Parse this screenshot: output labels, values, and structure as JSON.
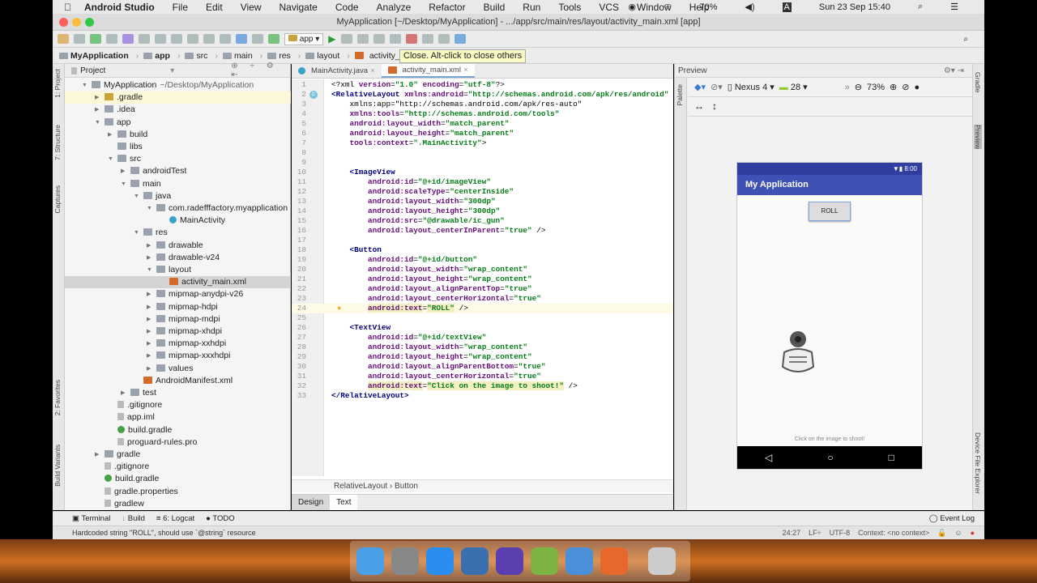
{
  "menubar": {
    "app": "Android Studio",
    "items": [
      "File",
      "Edit",
      "View",
      "Navigate",
      "Code",
      "Analyze",
      "Refactor",
      "Build",
      "Run",
      "Tools",
      "VCS",
      "Window",
      "Help"
    ],
    "battery": "70%",
    "datetime": "Sun 23 Sep  15:40"
  },
  "window": {
    "title": "MyApplication [~/Desktop/MyApplication] - .../app/src/main/res/layout/activity_main.xml [app]"
  },
  "toolbar": {
    "run_config": "app"
  },
  "breadcrumb": [
    "MyApplication",
    "app",
    "src",
    "main",
    "res",
    "layout",
    "activity_main.xml"
  ],
  "tooltip": "Close. Alt-click to close others",
  "left_strip": [
    "1: Project",
    "7: Structure",
    "Captures",
    "2: Favorites",
    "Build Variants"
  ],
  "project": {
    "header": "Project",
    "tree": [
      {
        "label": "MyApplication",
        "suffix": "~/Desktop/MyApplication",
        "level": 0,
        "icon": "folder",
        "open": true
      },
      {
        "label": ".gradle",
        "level": 1,
        "icon": "folder-yellow",
        "open": false,
        "hl": true
      },
      {
        "label": ".idea",
        "level": 1,
        "icon": "folder",
        "open": false
      },
      {
        "label": "app",
        "level": 1,
        "icon": "folder",
        "open": true
      },
      {
        "label": "build",
        "level": 2,
        "icon": "folder",
        "open": false
      },
      {
        "label": "libs",
        "level": 2,
        "icon": "folder"
      },
      {
        "label": "src",
        "level": 2,
        "icon": "folder",
        "open": true
      },
      {
        "label": "androidTest",
        "level": 3,
        "icon": "folder",
        "open": false
      },
      {
        "label": "main",
        "level": 3,
        "icon": "folder",
        "open": true
      },
      {
        "label": "java",
        "level": 4,
        "icon": "folder",
        "open": true
      },
      {
        "label": "com.radefffactory.myapplication",
        "level": 5,
        "icon": "folder",
        "open": true
      },
      {
        "label": "MainActivity",
        "level": 6,
        "icon": "class"
      },
      {
        "label": "res",
        "level": 4,
        "icon": "folder",
        "open": true
      },
      {
        "label": "drawable",
        "level": 5,
        "icon": "folder",
        "open": false
      },
      {
        "label": "drawable-v24",
        "level": 5,
        "icon": "folder",
        "open": false
      },
      {
        "label": "layout",
        "level": 5,
        "icon": "folder",
        "open": true
      },
      {
        "label": "activity_main.xml",
        "level": 6,
        "icon": "xml",
        "sel": true
      },
      {
        "label": "mipmap-anydpi-v26",
        "level": 5,
        "icon": "folder",
        "open": false
      },
      {
        "label": "mipmap-hdpi",
        "level": 5,
        "icon": "folder",
        "open": false
      },
      {
        "label": "mipmap-mdpi",
        "level": 5,
        "icon": "folder",
        "open": false
      },
      {
        "label": "mipmap-xhdpi",
        "level": 5,
        "icon": "folder",
        "open": false
      },
      {
        "label": "mipmap-xxhdpi",
        "level": 5,
        "icon": "folder",
        "open": false
      },
      {
        "label": "mipmap-xxxhdpi",
        "level": 5,
        "icon": "folder",
        "open": false
      },
      {
        "label": "values",
        "level": 5,
        "icon": "folder",
        "open": false
      },
      {
        "label": "AndroidManifest.xml",
        "level": 4,
        "icon": "manifest"
      },
      {
        "label": "test",
        "level": 3,
        "icon": "folder",
        "open": false
      },
      {
        "label": ".gitignore",
        "level": 2,
        "icon": "file"
      },
      {
        "label": "app.iml",
        "level": 2,
        "icon": "file"
      },
      {
        "label": "build.gradle",
        "level": 2,
        "icon": "gradle"
      },
      {
        "label": "proguard-rules.pro",
        "level": 2,
        "icon": "file"
      },
      {
        "label": "gradle",
        "level": 1,
        "icon": "folder",
        "open": false
      },
      {
        "label": ".gitignore",
        "level": 1,
        "icon": "file"
      },
      {
        "label": "build.gradle",
        "level": 1,
        "icon": "gradle"
      },
      {
        "label": "gradle.properties",
        "level": 1,
        "icon": "file"
      },
      {
        "label": "gradlew",
        "level": 1,
        "icon": "file"
      }
    ]
  },
  "editor": {
    "tabs": [
      {
        "label": "MainActivity.java",
        "active": false
      },
      {
        "label": "activity_main.xml",
        "active": true
      }
    ],
    "current_line": 24,
    "lines": [
      [
        [
          "p",
          "<?xml "
        ],
        [
          "a",
          "version"
        ],
        [
          "p",
          "="
        ],
        [
          "v",
          "\"1.0\""
        ],
        [
          "p",
          " "
        ],
        [
          "a",
          "encoding"
        ],
        [
          "p",
          "="
        ],
        [
          "v",
          "\"utf-8\""
        ],
        [
          "p",
          "?>"
        ]
      ],
      [
        [
          "t",
          "<RelativeLayout "
        ],
        [
          "a",
          "xmlns:android"
        ],
        [
          "p",
          "="
        ],
        [
          "v",
          "\"http://schemas.android.com/apk/res/android\""
        ]
      ],
      [
        [
          "p",
          "    xmlns:app=\"http://schemas.android.com/apk/res-auto\""
        ]
      ],
      [
        [
          "p",
          "    "
        ],
        [
          "a",
          "xmlns:tools"
        ],
        [
          "p",
          "="
        ],
        [
          "v",
          "\"http://schemas.android.com/tools\""
        ]
      ],
      [
        [
          "p",
          "    "
        ],
        [
          "a",
          "android:layout_width"
        ],
        [
          "p",
          "="
        ],
        [
          "v",
          "\"match_parent\""
        ]
      ],
      [
        [
          "p",
          "    "
        ],
        [
          "a",
          "android:layout_height"
        ],
        [
          "p",
          "="
        ],
        [
          "v",
          "\"match_parent\""
        ]
      ],
      [
        [
          "p",
          "    "
        ],
        [
          "a",
          "tools:context"
        ],
        [
          "p",
          "="
        ],
        [
          "v",
          "\".MainActivity\""
        ],
        [
          "p",
          ">"
        ]
      ],
      [],
      [],
      [
        [
          "p",
          "    "
        ],
        [
          "t",
          "<ImageView"
        ]
      ],
      [
        [
          "p",
          "        "
        ],
        [
          "a",
          "android:id"
        ],
        [
          "p",
          "="
        ],
        [
          "v",
          "\"@+id/imageView\""
        ]
      ],
      [
        [
          "p",
          "        "
        ],
        [
          "a",
          "android:scaleType"
        ],
        [
          "p",
          "="
        ],
        [
          "v",
          "\"centerInside\""
        ]
      ],
      [
        [
          "p",
          "        "
        ],
        [
          "a",
          "android:layout_width"
        ],
        [
          "p",
          "="
        ],
        [
          "v",
          "\"300dp\""
        ]
      ],
      [
        [
          "p",
          "        "
        ],
        [
          "a",
          "android:layout_height"
        ],
        [
          "p",
          "="
        ],
        [
          "v",
          "\"300dp\""
        ]
      ],
      [
        [
          "p",
          "        "
        ],
        [
          "a",
          "android:src"
        ],
        [
          "p",
          "="
        ],
        [
          "v",
          "\"@drawable/ic_gun\""
        ]
      ],
      [
        [
          "p",
          "        "
        ],
        [
          "a",
          "android:layout_centerInParent"
        ],
        [
          "p",
          "="
        ],
        [
          "v",
          "\"true\""
        ],
        [
          "p",
          " />"
        ]
      ],
      [],
      [
        [
          "p",
          "    "
        ],
        [
          "t",
          "<Button"
        ]
      ],
      [
        [
          "p",
          "        "
        ],
        [
          "a",
          "android:id"
        ],
        [
          "p",
          "="
        ],
        [
          "v",
          "\"@+id/button\""
        ]
      ],
      [
        [
          "p",
          "        "
        ],
        [
          "a",
          "android:layout_width"
        ],
        [
          "p",
          "="
        ],
        [
          "v",
          "\"wrap_content\""
        ]
      ],
      [
        [
          "p",
          "        "
        ],
        [
          "a",
          "android:layout_height"
        ],
        [
          "p",
          "="
        ],
        [
          "v",
          "\"wrap_content\""
        ]
      ],
      [
        [
          "p",
          "        "
        ],
        [
          "a",
          "android:layout_alignParentTop"
        ],
        [
          "p",
          "="
        ],
        [
          "v",
          "\"true\""
        ]
      ],
      [
        [
          "p",
          "        "
        ],
        [
          "a",
          "android:layout_centerHorizontal"
        ],
        [
          "p",
          "="
        ],
        [
          "v",
          "\"true\""
        ]
      ],
      [
        [
          "p",
          "        "
        ],
        [
          "a",
          "android:text"
        ],
        [
          "p",
          "="
        ],
        [
          "v",
          "\"ROLL\""
        ],
        [
          "p",
          " />"
        ]
      ],
      [],
      [
        [
          "p",
          "    "
        ],
        [
          "t",
          "<TextView"
        ]
      ],
      [
        [
          "p",
          "        "
        ],
        [
          "a",
          "android:id"
        ],
        [
          "p",
          "="
        ],
        [
          "v",
          "\"@+id/textView\""
        ]
      ],
      [
        [
          "p",
          "        "
        ],
        [
          "a",
          "android:layout_width"
        ],
        [
          "p",
          "="
        ],
        [
          "v",
          "\"wrap_content\""
        ]
      ],
      [
        [
          "p",
          "        "
        ],
        [
          "a",
          "android:layout_height"
        ],
        [
          "p",
          "="
        ],
        [
          "v",
          "\"wrap_content\""
        ]
      ],
      [
        [
          "p",
          "        "
        ],
        [
          "a",
          "android:layout_alignParentBottom"
        ],
        [
          "p",
          "="
        ],
        [
          "v",
          "\"true\""
        ]
      ],
      [
        [
          "p",
          "        "
        ],
        [
          "a",
          "android:layout_centerHorizontal"
        ],
        [
          "p",
          "="
        ],
        [
          "v",
          "\"true\""
        ]
      ],
      [
        [
          "p",
          "        "
        ],
        [
          "a",
          "android:text"
        ],
        [
          "p",
          "="
        ],
        [
          "v",
          "\"Click on the image to shoot!\""
        ],
        [
          "p",
          " />"
        ]
      ],
      [
        [
          "t",
          "</RelativeLayout>"
        ]
      ]
    ],
    "breadcrumb": [
      "RelativeLayout",
      "Button"
    ],
    "bottom_tabs": [
      "Design",
      "Text"
    ],
    "active_bottom_tab": "Text"
  },
  "preview": {
    "title": "Preview",
    "palette": "Palette",
    "device": "Nexus 4",
    "api": "28",
    "zoom": "73%",
    "phone": {
      "time": "8:00",
      "app_title": "My Application",
      "button": "ROLL",
      "text": "Click on the image to shoot!"
    }
  },
  "right_strip": [
    "Gradle",
    "Preview",
    "Device File Explorer"
  ],
  "bottom_tools": [
    "Terminal",
    "Build",
    "6: Logcat",
    "TODO"
  ],
  "event_log": "Event Log",
  "status": {
    "message": "Hardcoded string \"ROLL\", should use `@string` resource",
    "position": "24:27",
    "line_sep": "LF÷",
    "encoding": "UTF-8",
    "context": "Context: <no context>"
  }
}
